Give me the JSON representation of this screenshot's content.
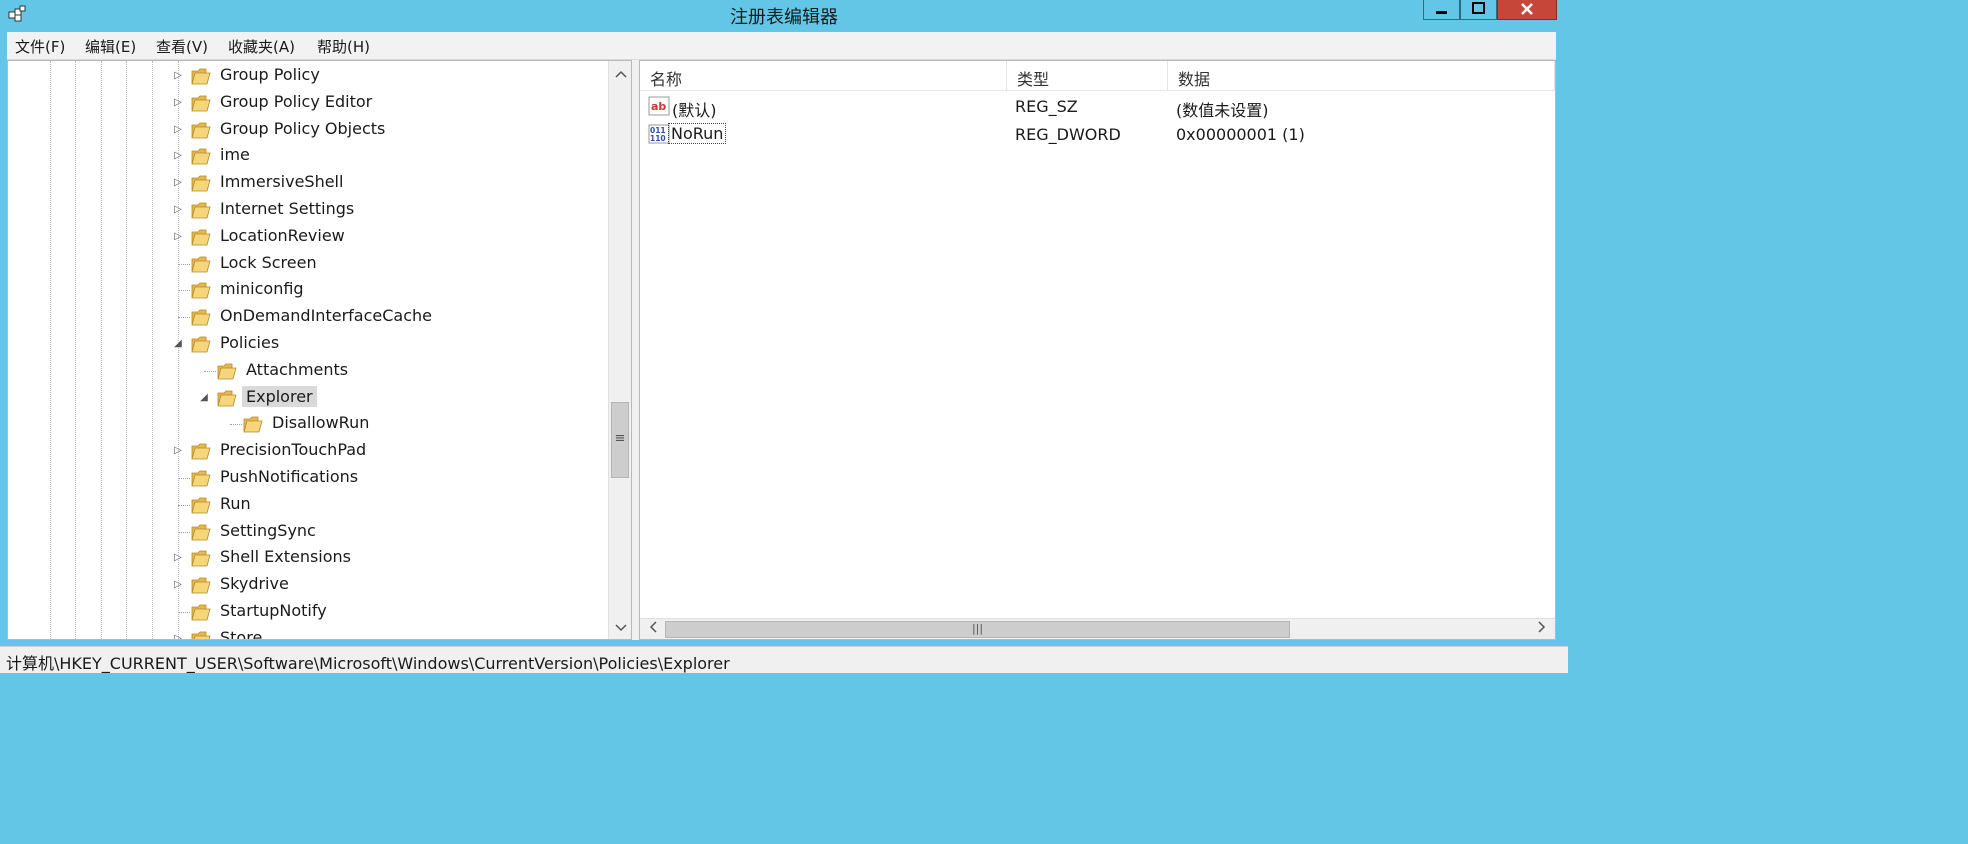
{
  "window": {
    "title": "注册表编辑器"
  },
  "menu": [
    "文件(F)",
    "编辑(E)",
    "查看(V)",
    "收藏夹(A)",
    "帮助(H)"
  ],
  "tree": [
    {
      "label": "Group Policy",
      "state": "collapsed"
    },
    {
      "label": "Group Policy Editor",
      "state": "collapsed"
    },
    {
      "label": "Group Policy Objects",
      "state": "collapsed"
    },
    {
      "label": "ime",
      "state": "collapsed"
    },
    {
      "label": "ImmersiveShell",
      "state": "collapsed"
    },
    {
      "label": "Internet Settings",
      "state": "collapsed"
    },
    {
      "label": "LocationReview",
      "state": "collapsed"
    },
    {
      "label": "Lock Screen",
      "state": "leaf"
    },
    {
      "label": "miniconfig",
      "state": "leaf"
    },
    {
      "label": "OnDemandInterfaceCache",
      "state": "leaf"
    },
    {
      "label": "Policies",
      "state": "expanded"
    },
    {
      "label": "Attachments",
      "state": "leaf"
    },
    {
      "label": "Explorer",
      "state": "expanded",
      "selected": true
    },
    {
      "label": "DisallowRun",
      "state": "leaf"
    },
    {
      "label": "PrecisionTouchPad",
      "state": "collapsed"
    },
    {
      "label": "PushNotifications",
      "state": "leaf"
    },
    {
      "label": "Run",
      "state": "leaf"
    },
    {
      "label": "SettingSync",
      "state": "leaf"
    },
    {
      "label": "Shell Extensions",
      "state": "collapsed"
    },
    {
      "label": "Skydrive",
      "state": "collapsed"
    },
    {
      "label": "StartupNotify",
      "state": "leaf"
    },
    {
      "label": "Store",
      "state": "collapsed"
    }
  ],
  "list": {
    "columns": [
      "名称",
      "类型",
      "数据"
    ],
    "rows": [
      {
        "name": "(默认)",
        "type": "REG_SZ",
        "data": "(数值未设置)",
        "icon": "string-value-icon"
      },
      {
        "name": "NoRun",
        "type": "REG_DWORD",
        "data": "0x00000001 (1)",
        "icon": "binary-value-icon"
      }
    ]
  },
  "status": {
    "path": "计算机\\HKEY_CURRENT_USER\\Software\\Microsoft\\Windows\\CurrentVersion\\Policies\\Explorer"
  },
  "colors": {
    "titlebar": "#63c6e6",
    "close": "#c7463a",
    "selection": "#d9d9d9",
    "folder": "#e8b84a"
  }
}
